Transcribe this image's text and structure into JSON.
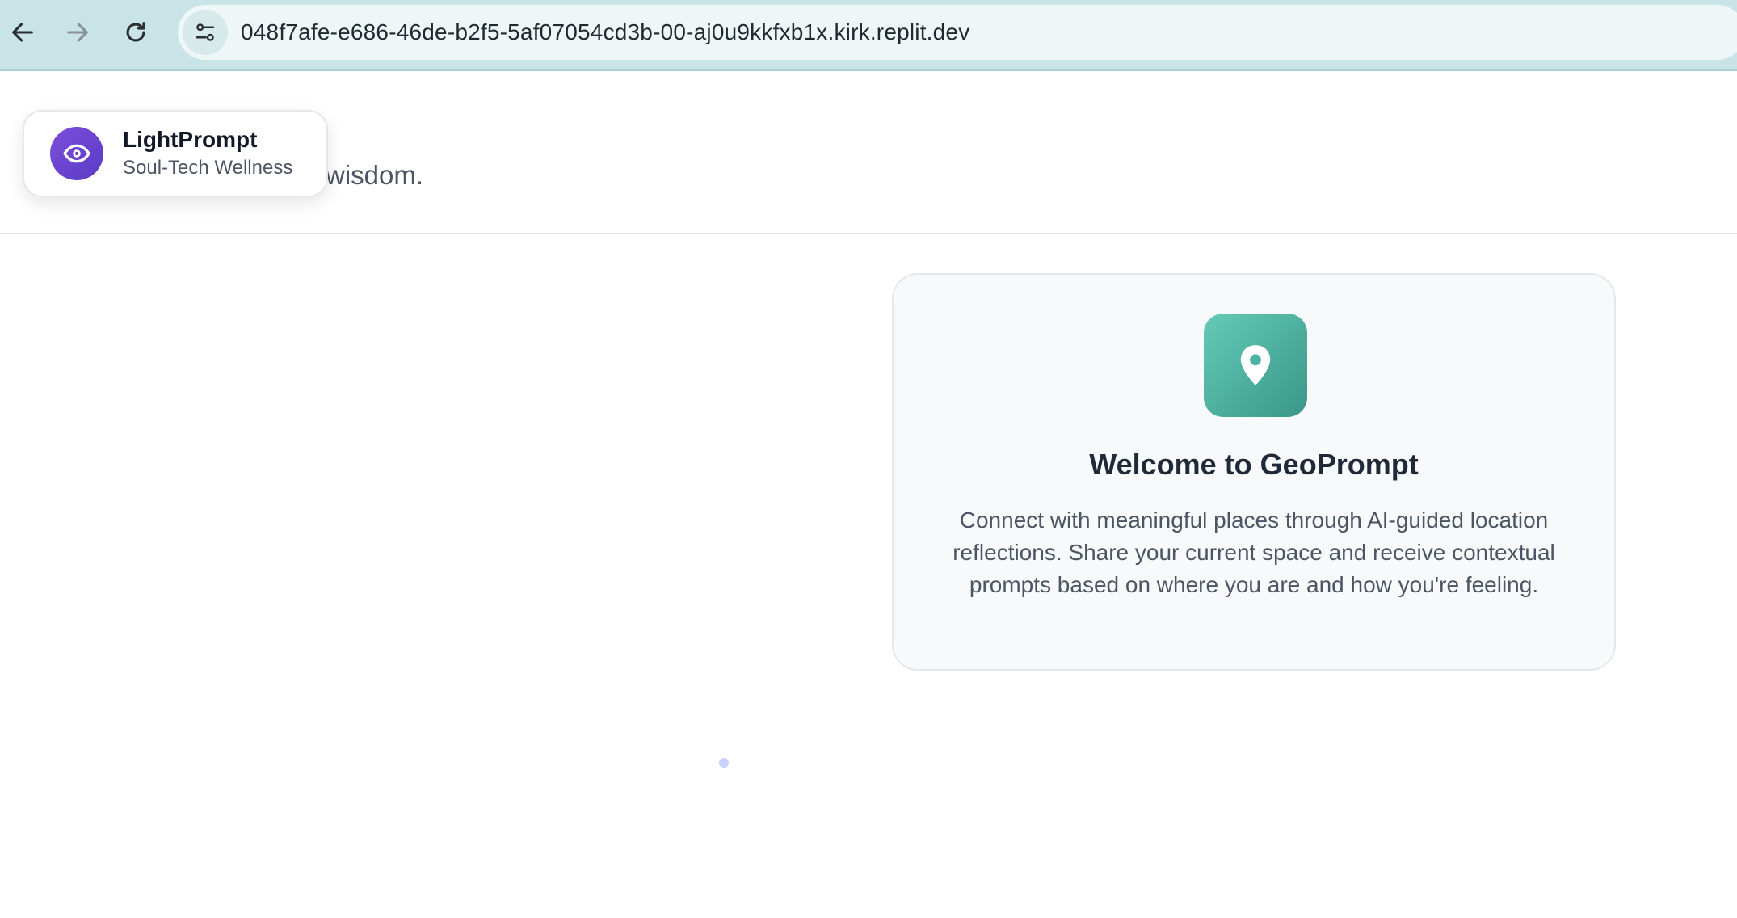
{
  "browser": {
    "url": "048f7afe-e686-46de-b2f5-5af07054cd3b-00-aj0u9kkfxb1x.kirk.replit.dev"
  },
  "hero": {
    "tagline_visible": "wisdom."
  },
  "brand": {
    "name": "LightPrompt",
    "subtitle": "Soul-Tech Wellness"
  },
  "welcome": {
    "title": "Welcome to GeoPrompt",
    "description": "Connect with meaningful places through AI-guided location reflections. Share your current space and receive contextual prompts based on where you are and how you're feeling."
  },
  "colors": {
    "brand_purple": "#6d45d4",
    "geo_teal": "#4fb3a3",
    "browser_bar": "#c8e4e6"
  },
  "icons": {
    "back": "arrow-left-icon",
    "forward": "arrow-right-icon",
    "reload": "reload-icon",
    "site_info": "tune-icon",
    "brand": "eye-icon",
    "geo": "map-pin-icon"
  }
}
